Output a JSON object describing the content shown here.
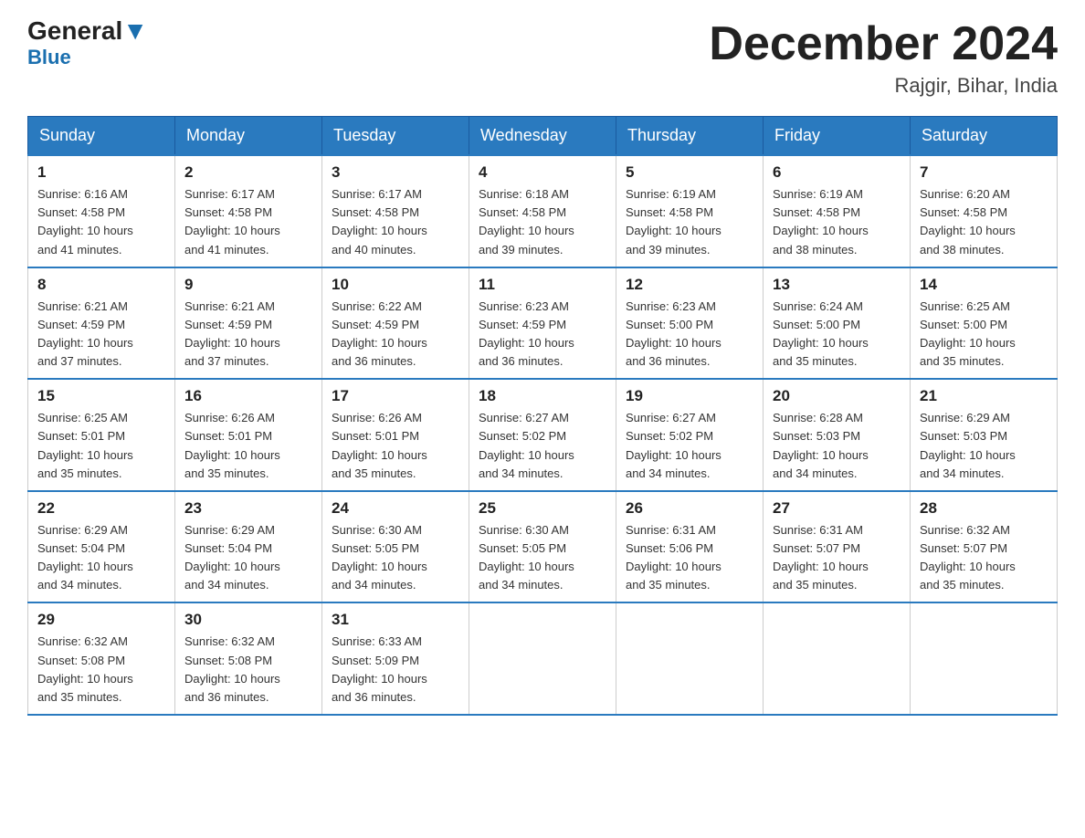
{
  "logo": {
    "text_general": "General",
    "text_blue": "Blue"
  },
  "title": "December 2024",
  "location": "Rajgir, Bihar, India",
  "days_of_week": [
    "Sunday",
    "Monday",
    "Tuesday",
    "Wednesday",
    "Thursday",
    "Friday",
    "Saturday"
  ],
  "weeks": [
    [
      {
        "day": "1",
        "sunrise": "6:16 AM",
        "sunset": "4:58 PM",
        "daylight": "10 hours and 41 minutes."
      },
      {
        "day": "2",
        "sunrise": "6:17 AM",
        "sunset": "4:58 PM",
        "daylight": "10 hours and 41 minutes."
      },
      {
        "day": "3",
        "sunrise": "6:17 AM",
        "sunset": "4:58 PM",
        "daylight": "10 hours and 40 minutes."
      },
      {
        "day": "4",
        "sunrise": "6:18 AM",
        "sunset": "4:58 PM",
        "daylight": "10 hours and 39 minutes."
      },
      {
        "day": "5",
        "sunrise": "6:19 AM",
        "sunset": "4:58 PM",
        "daylight": "10 hours and 39 minutes."
      },
      {
        "day": "6",
        "sunrise": "6:19 AM",
        "sunset": "4:58 PM",
        "daylight": "10 hours and 38 minutes."
      },
      {
        "day": "7",
        "sunrise": "6:20 AM",
        "sunset": "4:58 PM",
        "daylight": "10 hours and 38 minutes."
      }
    ],
    [
      {
        "day": "8",
        "sunrise": "6:21 AM",
        "sunset": "4:59 PM",
        "daylight": "10 hours and 37 minutes."
      },
      {
        "day": "9",
        "sunrise": "6:21 AM",
        "sunset": "4:59 PM",
        "daylight": "10 hours and 37 minutes."
      },
      {
        "day": "10",
        "sunrise": "6:22 AM",
        "sunset": "4:59 PM",
        "daylight": "10 hours and 36 minutes."
      },
      {
        "day": "11",
        "sunrise": "6:23 AM",
        "sunset": "4:59 PM",
        "daylight": "10 hours and 36 minutes."
      },
      {
        "day": "12",
        "sunrise": "6:23 AM",
        "sunset": "5:00 PM",
        "daylight": "10 hours and 36 minutes."
      },
      {
        "day": "13",
        "sunrise": "6:24 AM",
        "sunset": "5:00 PM",
        "daylight": "10 hours and 35 minutes."
      },
      {
        "day": "14",
        "sunrise": "6:25 AM",
        "sunset": "5:00 PM",
        "daylight": "10 hours and 35 minutes."
      }
    ],
    [
      {
        "day": "15",
        "sunrise": "6:25 AM",
        "sunset": "5:01 PM",
        "daylight": "10 hours and 35 minutes."
      },
      {
        "day": "16",
        "sunrise": "6:26 AM",
        "sunset": "5:01 PM",
        "daylight": "10 hours and 35 minutes."
      },
      {
        "day": "17",
        "sunrise": "6:26 AM",
        "sunset": "5:01 PM",
        "daylight": "10 hours and 35 minutes."
      },
      {
        "day": "18",
        "sunrise": "6:27 AM",
        "sunset": "5:02 PM",
        "daylight": "10 hours and 34 minutes."
      },
      {
        "day": "19",
        "sunrise": "6:27 AM",
        "sunset": "5:02 PM",
        "daylight": "10 hours and 34 minutes."
      },
      {
        "day": "20",
        "sunrise": "6:28 AM",
        "sunset": "5:03 PM",
        "daylight": "10 hours and 34 minutes."
      },
      {
        "day": "21",
        "sunrise": "6:29 AM",
        "sunset": "5:03 PM",
        "daylight": "10 hours and 34 minutes."
      }
    ],
    [
      {
        "day": "22",
        "sunrise": "6:29 AM",
        "sunset": "5:04 PM",
        "daylight": "10 hours and 34 minutes."
      },
      {
        "day": "23",
        "sunrise": "6:29 AM",
        "sunset": "5:04 PM",
        "daylight": "10 hours and 34 minutes."
      },
      {
        "day": "24",
        "sunrise": "6:30 AM",
        "sunset": "5:05 PM",
        "daylight": "10 hours and 34 minutes."
      },
      {
        "day": "25",
        "sunrise": "6:30 AM",
        "sunset": "5:05 PM",
        "daylight": "10 hours and 34 minutes."
      },
      {
        "day": "26",
        "sunrise": "6:31 AM",
        "sunset": "5:06 PM",
        "daylight": "10 hours and 35 minutes."
      },
      {
        "day": "27",
        "sunrise": "6:31 AM",
        "sunset": "5:07 PM",
        "daylight": "10 hours and 35 minutes."
      },
      {
        "day": "28",
        "sunrise": "6:32 AM",
        "sunset": "5:07 PM",
        "daylight": "10 hours and 35 minutes."
      }
    ],
    [
      {
        "day": "29",
        "sunrise": "6:32 AM",
        "sunset": "5:08 PM",
        "daylight": "10 hours and 35 minutes."
      },
      {
        "day": "30",
        "sunrise": "6:32 AM",
        "sunset": "5:08 PM",
        "daylight": "10 hours and 36 minutes."
      },
      {
        "day": "31",
        "sunrise": "6:33 AM",
        "sunset": "5:09 PM",
        "daylight": "10 hours and 36 minutes."
      },
      null,
      null,
      null,
      null
    ]
  ],
  "labels": {
    "sunrise": "Sunrise:",
    "sunset": "Sunset:",
    "daylight": "Daylight:"
  }
}
